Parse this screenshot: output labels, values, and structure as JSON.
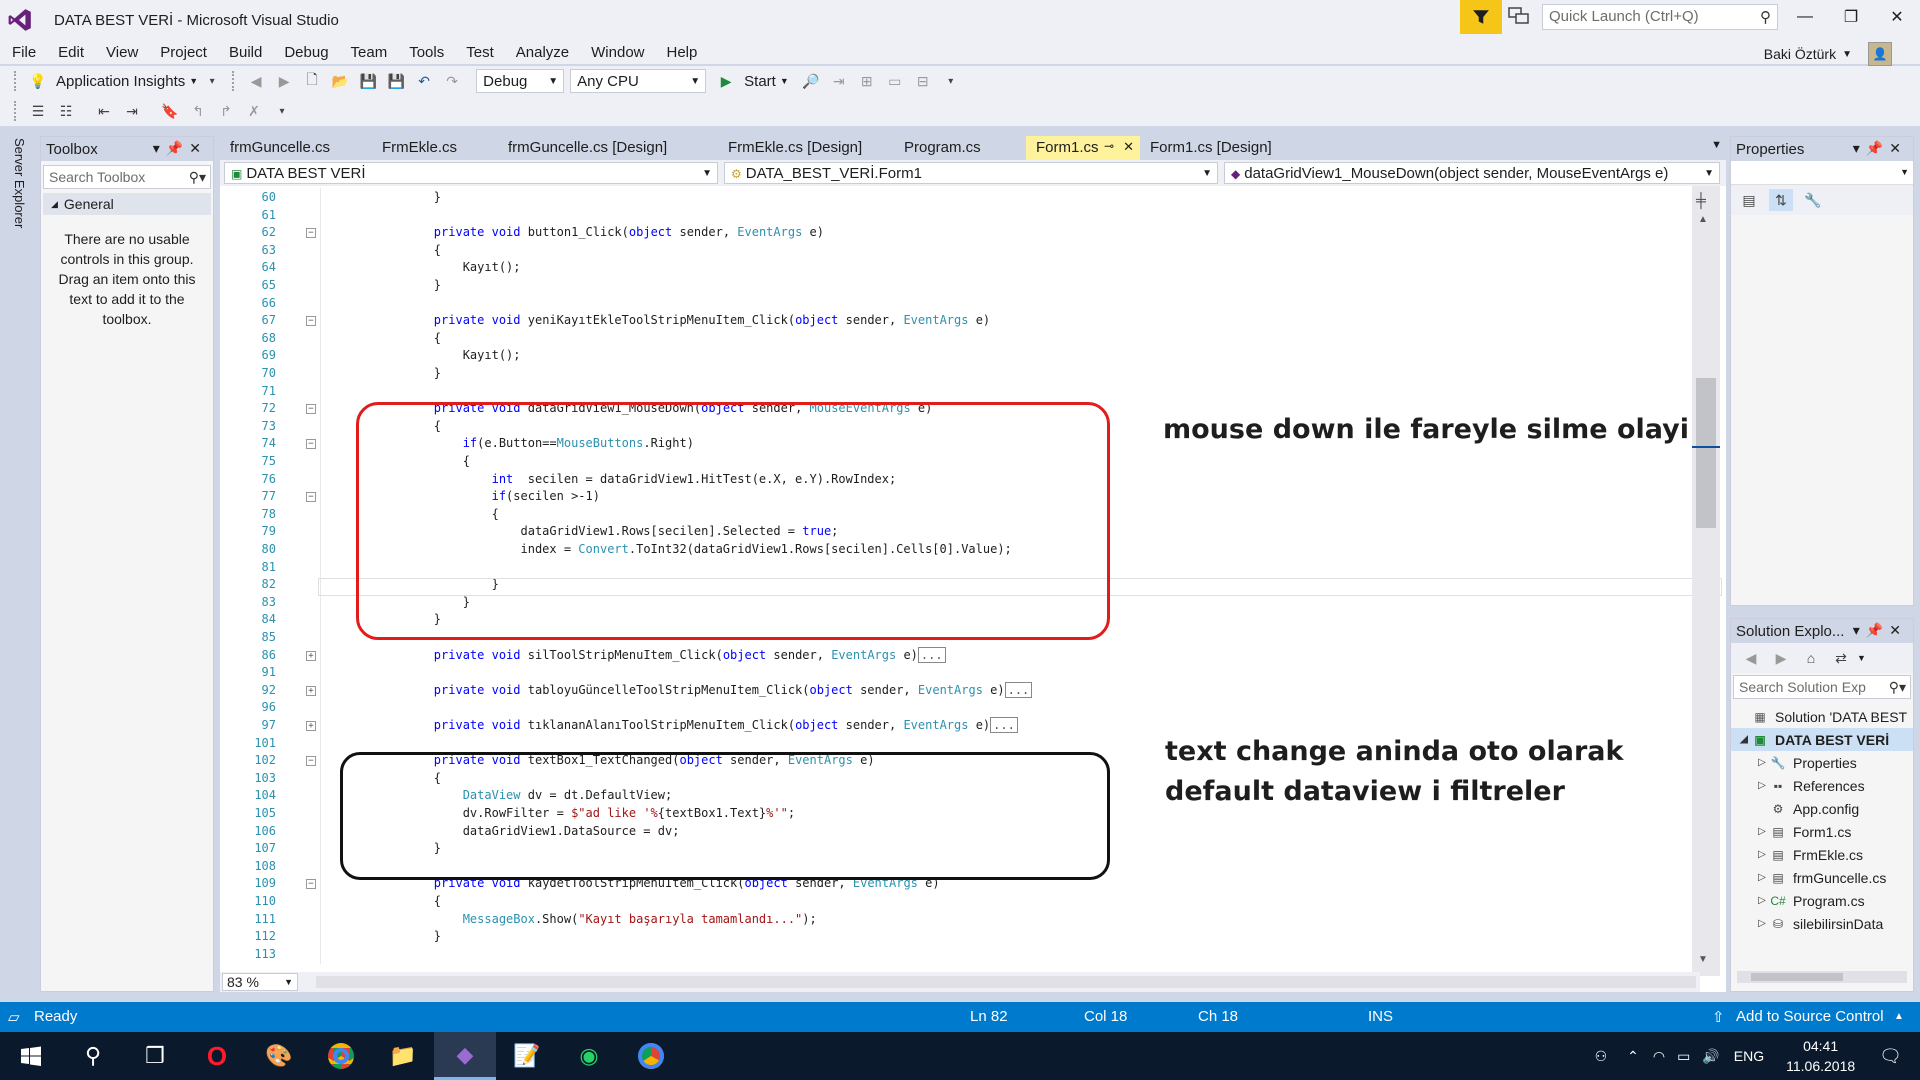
{
  "window": {
    "title": "DATA BEST VERİ - Microsoft Visual Studio"
  },
  "quick_launch": {
    "placeholder": "Quick Launch (Ctrl+Q)"
  },
  "user": {
    "name": "Baki Öztürk"
  },
  "menu": [
    "File",
    "Edit",
    "View",
    "Project",
    "Build",
    "Debug",
    "Team",
    "Tools",
    "Test",
    "Analyze",
    "Window",
    "Help"
  ],
  "toolbar": {
    "app_insights": "Application Insights",
    "config": "Debug",
    "platform": "Any CPU",
    "start": "Start"
  },
  "server_explorer": "Server Explorer",
  "toolbox": {
    "title": "Toolbox",
    "search_placeholder": "Search Toolbox",
    "group": "General",
    "empty_text": "There are no usable controls in this group. Drag an item onto this text to add it to the toolbox."
  },
  "tabs": [
    "frmGuncelle.cs",
    "FrmEkle.cs",
    "frmGuncelle.cs [Design]",
    "FrmEkle.cs [Design]",
    "Program.cs",
    "Form1.cs",
    "Form1.cs [Design]"
  ],
  "active_tab": "Form1.cs",
  "nav": {
    "project": "DATA BEST VERİ",
    "class": "DATA_BEST_VERİ.Form1",
    "member": "dataGridView1_MouseDown(object sender, MouseEventArgs e)"
  },
  "annotations": {
    "red": "mouse down ile fareyle silme olayi",
    "black_line1": "text change aninda oto olarak",
    "black_line2": "default dataview i filtreler"
  },
  "zoom": "83 %",
  "properties": {
    "title": "Properties"
  },
  "solution": {
    "title": "Solution Explo...",
    "search_placeholder": "Search Solution Exp",
    "items": [
      {
        "label": "Solution 'DATA BEST",
        "icon": "solution-icon",
        "level": 0,
        "tri": ""
      },
      {
        "label": "DATA BEST VERİ",
        "icon": "csharp-project-icon",
        "level": 0,
        "tri": "◢",
        "selected": true
      },
      {
        "label": "Properties",
        "icon": "wrench-icon",
        "level": 1,
        "tri": "▷"
      },
      {
        "label": "References",
        "icon": "references-icon",
        "level": 1,
        "tri": "▷"
      },
      {
        "label": "App.config",
        "icon": "config-file-icon",
        "level": 1,
        "tri": ""
      },
      {
        "label": "Form1.cs",
        "icon": "form-icon",
        "level": 1,
        "tri": "▷"
      },
      {
        "label": "FrmEkle.cs",
        "icon": "form-icon",
        "level": 1,
        "tri": "▷"
      },
      {
        "label": "frmGuncelle.cs",
        "icon": "form-icon",
        "level": 1,
        "tri": "▷"
      },
      {
        "label": "Program.cs",
        "icon": "csharp-file-icon",
        "level": 1,
        "tri": "▷"
      },
      {
        "label": "silebilirsinData",
        "icon": "database-icon",
        "level": 1,
        "tri": "▷"
      }
    ]
  },
  "status": {
    "ready": "Ready",
    "ln": "Ln 82",
    "col": "Col 18",
    "ch": "Ch 18",
    "ins": "INS",
    "source_control": "Add to Source Control"
  },
  "taskbar": {
    "lang": "ENG",
    "time": "04:41",
    "date": "11.06.2018"
  },
  "code_lines": [
    {
      "n": "60",
      "fold": "",
      "html": "        }"
    },
    {
      "n": "61",
      "fold": "",
      "html": ""
    },
    {
      "n": "62",
      "fold": "-",
      "html": "        <span class='kw'>private</span> <span class='kw'>void</span> button1_Click(<span class='kw'>object</span> sender, <span class='ty'>EventArgs</span> e)"
    },
    {
      "n": "63",
      "fold": "",
      "html": "        {"
    },
    {
      "n": "64",
      "fold": "",
      "html": "            Kayıt();"
    },
    {
      "n": "65",
      "fold": "",
      "html": "        }"
    },
    {
      "n": "66",
      "fold": "",
      "html": ""
    },
    {
      "n": "67",
      "fold": "-",
      "html": "        <span class='kw'>private</span> <span class='kw'>void</span> yeniKayıtEkleToolStripMenuItem_Click(<span class='kw'>object</span> sender, <span class='ty'>EventArgs</span> e)"
    },
    {
      "n": "68",
      "fold": "",
      "html": "        {"
    },
    {
      "n": "69",
      "fold": "",
      "html": "            Kayıt();"
    },
    {
      "n": "70",
      "fold": "",
      "html": "        }"
    },
    {
      "n": "71",
      "fold": "",
      "html": ""
    },
    {
      "n": "72",
      "fold": "-",
      "html": "        <span class='kw'>private</span> <span class='kw'>void</span> dataGridView1_MouseDown(<span class='kw'>object</span> sender, <span class='ty'>MouseEventArgs</span> e)"
    },
    {
      "n": "73",
      "fold": "",
      "html": "        {"
    },
    {
      "n": "74",
      "fold": "-",
      "html": "            <span class='kw'>if</span>(e.Button==<span class='ty'>MouseButtons</span>.Right)"
    },
    {
      "n": "75",
      "fold": "",
      "html": "            {"
    },
    {
      "n": "76",
      "fold": "",
      "html": "                <span class='kw'>int</span>  secilen = dataGridView1.HitTest(e.X, e.Y).RowIndex;"
    },
    {
      "n": "77",
      "fold": "-",
      "html": "                <span class='kw'>if</span>(secilen >-1)"
    },
    {
      "n": "78",
      "fold": "",
      "html": "                {"
    },
    {
      "n": "79",
      "fold": "",
      "html": "                    dataGridView1.Rows[secilen].Selected = <span class='kw'>true</span>;"
    },
    {
      "n": "80",
      "fold": "",
      "html": "                    index = <span class='ty'>Convert</span>.ToInt32(dataGridView1.Rows[secilen].Cells[0].Value);"
    },
    {
      "n": "81",
      "fold": "",
      "html": ""
    },
    {
      "n": "82",
      "fold": "",
      "html": "                }"
    },
    {
      "n": "83",
      "fold": "",
      "html": "            }"
    },
    {
      "n": "84",
      "fold": "",
      "html": "        }"
    },
    {
      "n": "85",
      "fold": "",
      "html": ""
    },
    {
      "n": "86",
      "fold": "+",
      "html": "        <span class='kw'>private</span> <span class='kw'>void</span> silToolStripMenuItem_Click(<span class='kw'>object</span> sender, <span class='ty'>EventArgs</span> e)<span class='collapsed'>...</span>"
    },
    {
      "n": "91",
      "fold": "",
      "html": ""
    },
    {
      "n": "92",
      "fold": "+",
      "html": "        <span class='kw'>private</span> <span class='kw'>void</span> tabloyuGüncelleToolStripMenuItem_Click(<span class='kw'>object</span> sender, <span class='ty'>EventArgs</span> e)<span class='collapsed'>...</span>"
    },
    {
      "n": "96",
      "fold": "",
      "html": ""
    },
    {
      "n": "97",
      "fold": "+",
      "html": "        <span class='kw'>private</span> <span class='kw'>void</span> tıklananAlanıToolStripMenuItem_Click(<span class='kw'>object</span> sender, <span class='ty'>EventArgs</span> e)<span class='collapsed'>...</span>"
    },
    {
      "n": "101",
      "fold": "",
      "html": ""
    },
    {
      "n": "102",
      "fold": "-",
      "html": "        <span class='kw'>private</span> <span class='kw'>void</span> textBox1_TextChanged(<span class='kw'>object</span> sender, <span class='ty'>EventArgs</span> e)"
    },
    {
      "n": "103",
      "fold": "",
      "html": "        {"
    },
    {
      "n": "104",
      "fold": "",
      "html": "            <span class='ty'>DataView</span> dv = dt.DefaultView;"
    },
    {
      "n": "105",
      "fold": "",
      "html": "            dv.RowFilter = <span class='st'>$\"ad like '%</span>{textBox1.Text}<span class='st'>%'\"</span>;"
    },
    {
      "n": "106",
      "fold": "",
      "html": "            dataGridView1.DataSource = dv;"
    },
    {
      "n": "107",
      "fold": "",
      "html": "        }"
    },
    {
      "n": "108",
      "fold": "",
      "html": ""
    },
    {
      "n": "109",
      "fold": "-",
      "html": "        <span class='kw'>private</span> <span class='kw'>void</span> kaydetToolStripMenuItem_Click(<span class='kw'>object</span> sender, <span class='ty'>EventArgs</span> e)"
    },
    {
      "n": "110",
      "fold": "",
      "html": "        {"
    },
    {
      "n": "111",
      "fold": "",
      "html": "            <span class='ty'>MessageBox</span>.Show(<span class='st'>\"Kayıt başarıyla tamamlandı...\"</span>);"
    },
    {
      "n": "112",
      "fold": "",
      "html": "        }"
    },
    {
      "n": "113",
      "fold": "",
      "html": ""
    }
  ]
}
